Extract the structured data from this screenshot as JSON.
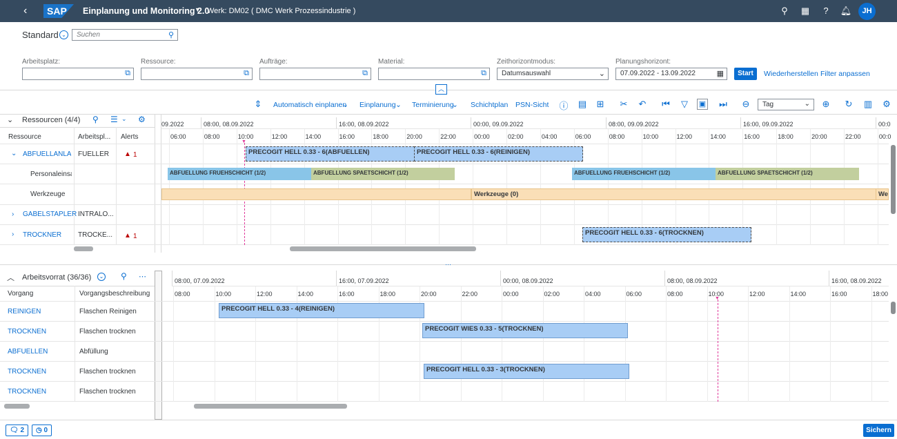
{
  "shell": {
    "app_title": "Einplanung und Monitoring 2.0",
    "werk": "Werk: DM02 ( DMC Werk Prozessindustrie )",
    "user_initials": "JH",
    "logo": "SAP"
  },
  "filterbar": {
    "variant": "Standard",
    "search_placeholder": "Suchen",
    "labels": {
      "arbeitsplatz": "Arbeitsplatz:",
      "ressource": "Ressource:",
      "auftraege": "Aufträge:",
      "material": "Material:",
      "zeithorizont": "Zeithorizontmodus:",
      "planungshorizont": "Planungshorizont:"
    },
    "zeithorizont_value": "Datumsauswahl",
    "planungshorizont_value": "07.09.2022 - 13.09.2022",
    "start": "Start",
    "restore": "Wiederherstellen",
    "adapt": "Filter anpassen"
  },
  "toolbar": {
    "auto_plan": "Automatisch einplanen",
    "einplanung": "Einplanung",
    "terminierung": "Terminierung",
    "schichtplan": "Schichtplan",
    "psn": "PSN-Sicht",
    "zoom": "Tag"
  },
  "resources": {
    "title": "Ressourcen (4/4)",
    "columns": [
      "Ressource",
      "Arbeitspl...",
      "Alerts"
    ],
    "rows": [
      {
        "name": "ABFUELLANLAG",
        "workcenter": "FUELLER",
        "alerts": "1"
      },
      {
        "name": "Personaleinsa",
        "workcenter": "",
        "alerts": ""
      },
      {
        "name": "Werkzeuge",
        "workcenter": "",
        "alerts": ""
      },
      {
        "name": "GABELSTAPLER",
        "workcenter": "INTRALO...",
        "alerts": ""
      },
      {
        "name": "TROCKNER",
        "workcenter": "TROCKE...",
        "alerts": "1"
      }
    ],
    "date_labels": [
      "09.2022",
      "08:00, 08.09.2022",
      "16:00, 08.09.2022",
      "00:00, 09.09.2022",
      "08:00, 09.09.2022",
      "16:00, 09.09.2022",
      "00:0"
    ],
    "hour_labels": [
      "06:00",
      "08:00",
      "10:00",
      "12:00",
      "14:00",
      "16:00",
      "18:00",
      "20:00",
      "22:00",
      "00:00",
      "02:00",
      "04:00",
      "06:00",
      "08:00",
      "10:00",
      "12:00",
      "14:00",
      "16:00",
      "18:00",
      "20:00",
      "22:00",
      "00:0"
    ],
    "bars": {
      "abf1": "PRECOGIT HELL 0.33 - 6(ABFUELLEN)",
      "abf2": "PRECOGIT HELL 0.33 - 6(REINIGEN)",
      "shift1": "ABFUELLUNG FRUEHSCHICHT (1/2)",
      "shift2": "ABFUELLUNG SPAETSCHICHT (1/2)",
      "shift3": "ABFUELLUNG FRUEHSCHICHT (1/2)",
      "shift4": "ABFUELLUNG SPAETSCHICHT (1/2)",
      "tools": "Werkzeuge (0)",
      "tools2": "Wer",
      "trock": "PRECOGIT HELL 0.33 - 6(TROCKNEN)"
    }
  },
  "backlog": {
    "title": "Arbeitsvorrat (36/36)",
    "columns": [
      "Vorgang",
      "Vorgangsbeschreibung"
    ],
    "rows": [
      {
        "op": "REINIGEN",
        "desc": "Flaschen Reinigen"
      },
      {
        "op": "TROCKNEN",
        "desc": "Flaschen trocknen"
      },
      {
        "op": "ABFUELLEN",
        "desc": "Abfüllung"
      },
      {
        "op": "TROCKNEN",
        "desc": "Flaschen trocknen"
      },
      {
        "op": "TROCKNEN",
        "desc": "Flaschen trocknen"
      }
    ],
    "date_labels": [
      "08:00, 07.09.2022",
      "16:00, 07.09.2022",
      "00:00, 08.09.2022",
      "08:00, 08.09.2022",
      "16:00, 08.09.2022"
    ],
    "hour_labels": [
      "08:00",
      "10:00",
      "12:00",
      "14:00",
      "16:00",
      "18:00",
      "20:00",
      "22:00",
      "00:00",
      "02:00",
      "04:00",
      "06:00",
      "08:00",
      "10:00",
      "12:00",
      "14:00",
      "16:00",
      "18:00"
    ],
    "bars": {
      "b1": "PRECOGIT HELL 0.33 - 4(REINIGEN)",
      "b2": "PRECOGIT WIES 0.33 - 5(TROCKNEN)",
      "b3": "PRECOGIT HELL 0.33 - 3(TROCKNEN)"
    }
  },
  "footer": {
    "messages": "2",
    "notifications": "0",
    "save": "Sichern"
  }
}
